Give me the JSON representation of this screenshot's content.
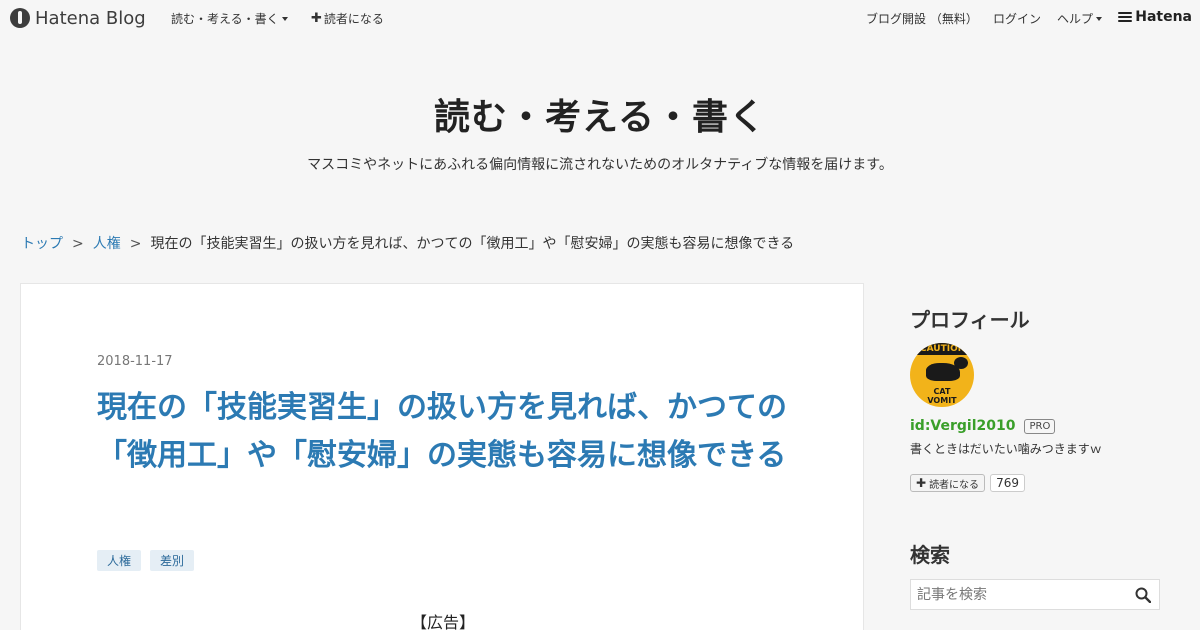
{
  "topbar": {
    "logo_text": "Hatena Blog",
    "blog_menu_label": "読む・考える・書く",
    "subscribe_label": "読者になる",
    "open_blog_label": "ブログ開設 （無料）",
    "login_label": "ログイン",
    "help_label": "ヘルプ",
    "brand_label": "Hatena"
  },
  "blog": {
    "title": "読む・考える・書く",
    "description": "マスコミやネットにあふれる偏向情報に流されないためのオルタナティブな情報を届けます。"
  },
  "breadcrumb": {
    "top": "トップ",
    "category": "人権",
    "current": "現在の「技能実習生」の扱い方を見れば、かつての「徴用工」や「慰安婦」の実態も容易に想像できる",
    "separator": ">"
  },
  "entry": {
    "date": "2018-11-17",
    "title": "現在の「技能実習生」の扱い方を見れば、かつての「徴用工」や「慰安婦」の実態も容易に想像できる",
    "tags": [
      "人権",
      "差別"
    ],
    "ad_label": "【広告】"
  },
  "sidebar": {
    "profile_title": "プロフィール",
    "avatar_top_text": "CAUTION",
    "avatar_bottom_text_1": "CAT",
    "avatar_bottom_text_2": "VOMIT",
    "user_id": "id:Vergil2010",
    "pro_badge": "PRO",
    "profile_desc": "書くときはだいたい噛みつきますｗ",
    "subscribe_label": "読者になる",
    "subscriber_count": "769",
    "search_title": "検索",
    "search_placeholder": "記事を検索"
  },
  "colors": {
    "link": "#2c7ab3",
    "user_id": "#3a9f2a",
    "background": "#f6f6f6"
  }
}
